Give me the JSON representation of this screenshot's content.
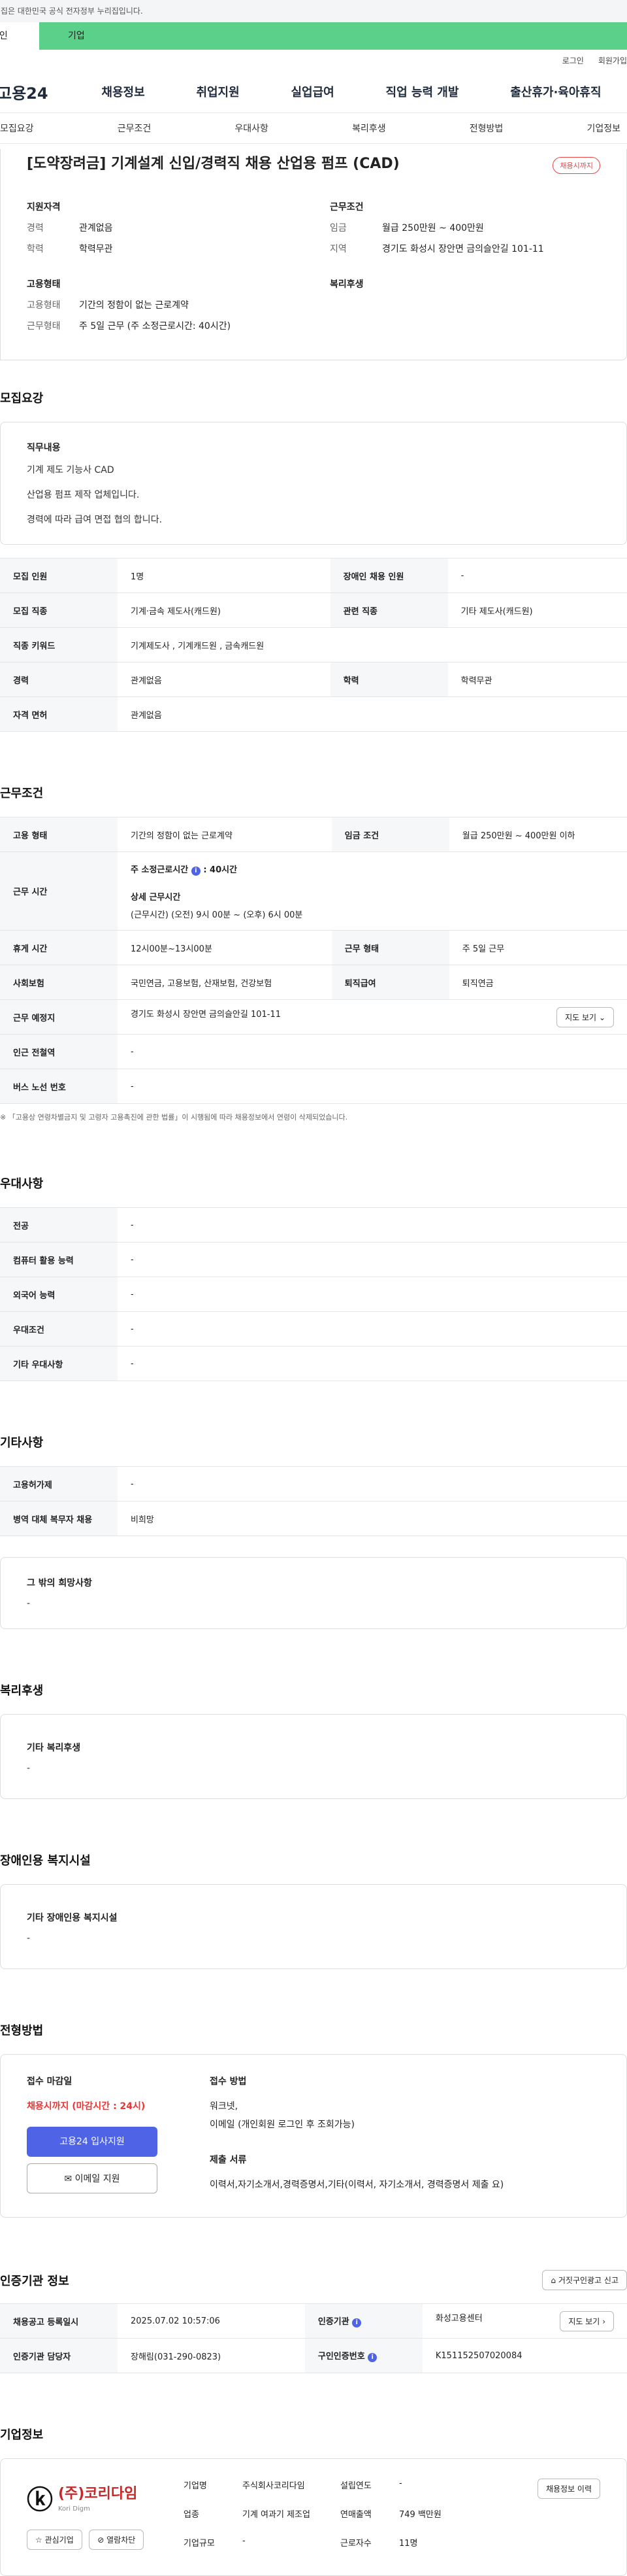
{
  "gov_notice": "이 누리집은 대한민국 공식 전자정부 누리집입니다.",
  "top_tabs": [
    "개인",
    "기업"
  ],
  "util_links": [
    "로그인",
    "회원가입"
  ],
  "site_logo": "고용24",
  "gnb": [
    "채용정보",
    "취업지원",
    "실업급여",
    "직업 능력 개발",
    "출산휴가·육아휴직"
  ],
  "anchors": [
    "모집요강",
    "근무조건",
    "우대사항",
    "복리후생",
    "전형방법",
    "기업정보"
  ],
  "title": "[도약장려금] 기계설계 신입/경력직 채용 산업용 펌프 (CAD)",
  "badge": "채용시까지",
  "summary": {
    "left_title": "지원자격",
    "right_title": "근무조건",
    "rows1": [
      {
        "k": "경력",
        "v": "관계없음"
      },
      {
        "k": "학력",
        "v": "학력무관"
      }
    ],
    "rows2": [
      {
        "k": "임금",
        "v": "월급 250만원 ~ 400만원"
      },
      {
        "k": "지역",
        "v": "경기도 화성시 장안면 금의슬안길 101-11"
      }
    ],
    "left_title2": "고용형태",
    "right_title2": "복리후생",
    "rows3": [
      {
        "k": "고용형태",
        "v": "기간의 정함이 없는 근로계약"
      },
      {
        "k": "근무형태",
        "v": "주 5일 근무 (주 소정근로시간: 40시간)"
      }
    ]
  },
  "recruit": {
    "title": "모집요강",
    "job_title": "직무내용",
    "desc": [
      "기계 제도 기능사 CAD",
      "산업용 펌프 제작 업체입니다.",
      "경력에 따라 급여 면접 협의 합니다."
    ],
    "table": [
      [
        "모집 인원",
        "1명",
        "장애인 채용 인원",
        "-"
      ],
      [
        "모집 직종",
        "기계·금속 제도사(캐드원)",
        "관련 직종",
        "기타 제도사(캐드원)"
      ],
      [
        "직종 키워드",
        "기계제도사 , 기계캐드원 , 금속캐드원"
      ],
      [
        "경력",
        "관계없음",
        "학력",
        "학력무관"
      ],
      [
        "자격 면허",
        "관계없음"
      ]
    ]
  },
  "work": {
    "title": "근무조건",
    "r1": [
      "고용 형태",
      "기간의 정함이 없는 근로계약",
      "임금 조건",
      "월급 250만원 ~ 400만원 이하"
    ],
    "hours_label": "근무 시간",
    "hours_main": "주 소정근로시간",
    "hours_val": ": 40시간",
    "hours_detail": "상세 근무시간",
    "hours_detail_val": "(근무시간) (오전) 9시 00분 ~ (오후) 6시 00분",
    "r2": [
      "휴게 시간",
      "12시00분~13시00분",
      "근무 형태",
      "주 5일 근무"
    ],
    "r3": [
      "사회보험",
      "국민연금, 고용보험, 산재보험, 건강보험",
      "퇴직급여",
      "퇴직연금"
    ],
    "r4": [
      "근무 예정지",
      "경기도 화성시 장안면 금의슬안길 101-11"
    ],
    "map_btn": "지도 보기",
    "r5": [
      "인근 전철역",
      "-"
    ],
    "r6": [
      "버스 노선 번호",
      "-"
    ],
    "note": "※ 「고용상 연령차별금지 및 고령자 고용촉진에 관한 법률」이 시행됨에 따라 채용정보에서 연령이 삭제되었습니다."
  },
  "pref": {
    "title": "우대사항",
    "rows": [
      [
        "전공",
        "-"
      ],
      [
        "컴퓨터 활용 능력",
        "-"
      ],
      [
        "외국어 능력",
        "-"
      ],
      [
        "우대조건",
        "-"
      ],
      [
        "기타 우대사항",
        "-"
      ]
    ]
  },
  "other": {
    "title": "기타사항",
    "rows": [
      [
        "고용허가제",
        "-"
      ],
      [
        "병역 대체 복무자 채용",
        "비희망"
      ]
    ],
    "box_title": "그 밖의 희망사항",
    "box_val": "-"
  },
  "welfare": {
    "title": "복리후생",
    "box_title": "기타 복리후생",
    "box_val": "-"
  },
  "disab": {
    "title": "장애인용 복지시설",
    "box_title": "기타 장애인용 복지시설",
    "box_val": "-"
  },
  "process": {
    "title": "전형방법",
    "deadline_title": "접수 마감일",
    "deadline_val": "채용시까지 (마감시간 : 24시)",
    "apply_btn": "고용24 입사지원",
    "email_btn": "이메일 지원",
    "method_title": "접수 방법",
    "method_val": [
      "워크넷,",
      "이메일 (개인회원 로그인 후 조회가능)"
    ],
    "docs_title": "제출 서류",
    "docs_val": "이력서,자기소개서,경력증명서,기타(이력서, 자기소개서, 경력증명서 제출 요)"
  },
  "cert": {
    "title": "인증기관 정보",
    "report_btn": "거짓구인광고 신고",
    "rows": [
      [
        "채용공고 등록일시",
        "2025.07.02 10:57:06",
        "인증기관",
        "화성고용센터"
      ],
      [
        "인증기관 담당자",
        "장해림(031-290-0823)",
        "구인인증번호",
        "K151152507020084"
      ]
    ],
    "map_btn": "지도 보기"
  },
  "company": {
    "title": "기업정보",
    "logo_text": "(주)코리다임",
    "logo_sub": "Kori Digm",
    "fav_btn": "관심기업",
    "block_btn": "열람차단",
    "labels": [
      "기업명",
      "업종",
      "기업규모",
      "설립연도",
      "연매출액",
      "근로자수"
    ],
    "vals": [
      "주식회사코리다임",
      "기계 여과기 제조업",
      "-",
      "-",
      "749 백만원",
      "11명"
    ],
    "history_btn": "채용정보 이력"
  }
}
